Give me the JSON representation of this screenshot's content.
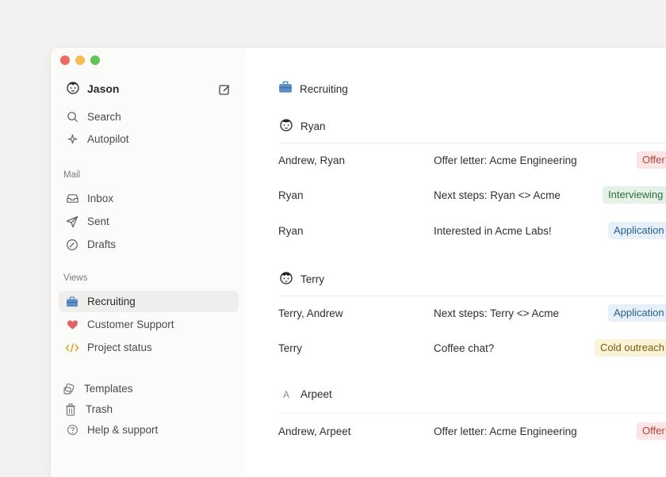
{
  "sidebar": {
    "account": {
      "name": "Jason"
    },
    "search_label": "Search",
    "autopilot_label": "Autopilot",
    "mail_section": "Mail",
    "mail_items": [
      {
        "label": "Inbox",
        "icon": "inbox-icon"
      },
      {
        "label": "Sent",
        "icon": "send-icon"
      },
      {
        "label": "Drafts",
        "icon": "drafts-icon"
      }
    ],
    "views_section": "Views",
    "views_items": [
      {
        "label": "Recruiting",
        "icon": "briefcase-icon",
        "active": true
      },
      {
        "label": "Customer Support",
        "icon": "heart-icon"
      },
      {
        "label": "Project status",
        "icon": "code-icon"
      }
    ],
    "footer_items": [
      {
        "label": "Templates",
        "icon": "templates-icon"
      },
      {
        "label": "Trash",
        "icon": "trash-icon"
      },
      {
        "label": "Help & support",
        "icon": "help-icon"
      }
    ]
  },
  "main": {
    "view_title": "Recruiting",
    "groups": [
      {
        "name": "Ryan",
        "avatar": "face",
        "rows": [
          {
            "from": "Andrew, Ryan",
            "subject": "Offer letter: Acme Engineering",
            "tag": "Offer"
          },
          {
            "from": "Ryan",
            "subject": "Next steps: Ryan <> Acme",
            "tag": "Interviewing"
          },
          {
            "from": "Ryan",
            "subject": "Interested in Acme Labs!",
            "tag": "Application"
          }
        ]
      },
      {
        "name": "Terry",
        "avatar": "face",
        "rows": [
          {
            "from": "Terry, Andrew",
            "subject": "Next steps: Terry <> Acme",
            "tag": "Application"
          },
          {
            "from": "Terry",
            "subject": "Coffee chat?",
            "tag": "Cold outreach"
          }
        ]
      },
      {
        "name": "Arpeet",
        "avatar_letter": "A",
        "rows": [
          {
            "from": "Andrew, Arpeet",
            "subject": "Offer letter: Acme Engineering",
            "tag": "Offer"
          }
        ]
      }
    ]
  },
  "colors": {
    "offer": "#fbe4e3",
    "interviewing": "#e3f1e6",
    "application": "#e5f0f8",
    "cold_outreach": "#fbf3d6",
    "active_nav": "#efeeec"
  }
}
